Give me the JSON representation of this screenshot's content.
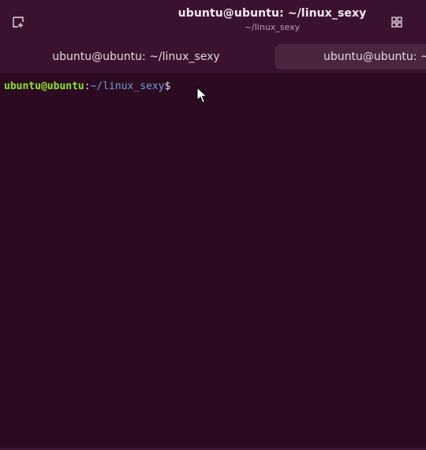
{
  "window": {
    "title": "ubuntu@ubuntu: ~/linux_sexy",
    "subtitle": "~/linux_sexy"
  },
  "icons": {
    "new_tab": "new-tab-icon",
    "menu": "grid-menu-icon",
    "pointer": "mouse-pointer-icon"
  },
  "tabs": [
    {
      "label": "ubuntu@ubuntu: ~/linux_sexy"
    },
    {
      "label": "ubuntu@ubuntu: ~"
    }
  ],
  "terminal": {
    "user_host": "ubuntu@ubuntu",
    "colon": ":",
    "path": "~/linux_sexy",
    "dollar": "$"
  },
  "colors": {
    "background": "#2c0a22",
    "titlebar": "#3a1230",
    "prompt_user": "#8ae234",
    "prompt_path": "#729fcf"
  }
}
